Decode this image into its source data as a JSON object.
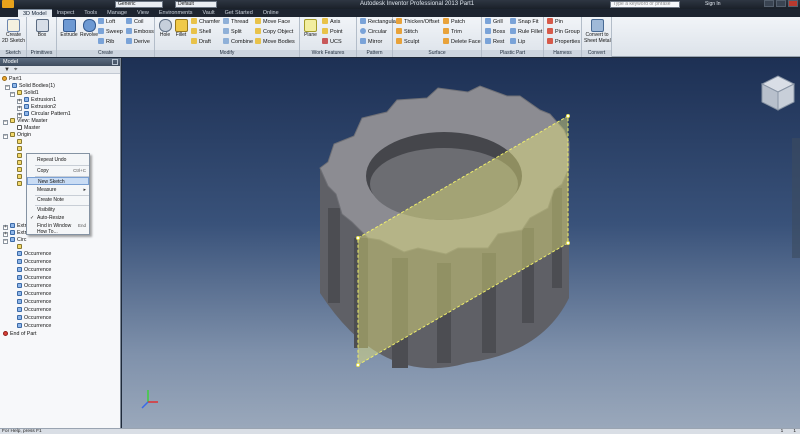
{
  "titlebar": {
    "app_title": "Autodesk Inventor Professional 2013    Part1",
    "material": "Generic",
    "appearance": "Default",
    "search_placeholder": "Type a keyword or phrase",
    "sign_in": "Sign In"
  },
  "tabs": [
    "3D Model",
    "Inspect",
    "Tools",
    "Manage",
    "View",
    "Environments",
    "Vault",
    "Get Started",
    "Online"
  ],
  "ribbon": {
    "sketch": {
      "title": "Sketch",
      "create_2d": "Create",
      "create_2d_sub": "2D Sketch"
    },
    "primitives": {
      "title": "Primitives",
      "box": "Box"
    },
    "create": {
      "title": "Create",
      "extrude": "Extrude",
      "revolve": "Revolve",
      "loft": "Loft",
      "sweep": "Sweep",
      "rib": "Rib",
      "coil": "Coil",
      "emboss": "Emboss",
      "derive": "Derive"
    },
    "modify": {
      "title": "Modify",
      "hole": "Hole",
      "fillet": "Fillet",
      "chamfer": "Chamfer",
      "shell": "Shell",
      "draft": "Draft",
      "thread": "Thread",
      "split": "Split",
      "combine": "Combine",
      "move_face": "Move Face",
      "copy_object": "Copy Object",
      "move_bodies": "Move Bodies"
    },
    "work_features": {
      "title": "Work Features",
      "plane": "Plane",
      "axis": "Axis",
      "point": "Point",
      "ucs": "UCS"
    },
    "pattern": {
      "title": "Pattern",
      "rectangular": "Rectangular",
      "circular": "Circular",
      "mirror": "Mirror"
    },
    "surface": {
      "title": "Surface",
      "thicken": "Thicken/Offset",
      "stitch": "Stitch",
      "sculpt": "Sculpt",
      "patch": "Patch",
      "trim": "Trim",
      "delete_face": "Delete Face"
    },
    "plastic_part": {
      "title": "Plastic Part",
      "grill": "Grill",
      "boss": "Boss",
      "rest": "Rest",
      "snap_fit": "Snap Fit",
      "rule_fillet": "Rule Fillet",
      "lip": "Lip"
    },
    "harness": {
      "title": "Harness",
      "pin": "Pin",
      "pin_group": "Pin Group",
      "properties": "Properties"
    },
    "convert": {
      "title": "Convert",
      "label": "Convert to",
      "label2": "Sheet Metal"
    }
  },
  "browser": {
    "header": "Model",
    "tree": [
      "Part1",
      "Solid Bodies(1)",
      "Solid1",
      "Extrusion1",
      "Extrusion2",
      "Circular Pattern1",
      "View: Master",
      "Master",
      "Origin",
      "Extr",
      "Extr",
      "Circ",
      "Occurrence",
      "Occurrence",
      "Occurrence",
      "Occurrence",
      "Occurrence",
      "Occurrence",
      "Occurrence",
      "Occurrence",
      "Occurrence",
      "Occurrence",
      "End of Part"
    ]
  },
  "context_menu": {
    "items": [
      {
        "label": "Repeat Undo",
        "shortcut": ""
      },
      {
        "label": "Copy",
        "shortcut": "Ctrl+C"
      },
      {
        "label": "New Sketch",
        "shortcut": ""
      },
      {
        "label": "Measure",
        "shortcut": ""
      },
      {
        "label": "Create Note",
        "shortcut": ""
      },
      {
        "label": "Visibility",
        "shortcut": ""
      },
      {
        "label": "Auto-Resize",
        "shortcut": ""
      },
      {
        "label": "Find in Window",
        "shortcut": "End"
      },
      {
        "label": "How To...",
        "shortcut": ""
      }
    ],
    "highlighted_index": 2
  },
  "status": {
    "help": "For Help, press F1",
    "count1": "1",
    "count2": "1"
  },
  "colors": {
    "gear_face": "#8c8c92",
    "gear_side": "#55565c",
    "plane_fill": "#e6e57a",
    "plane_edge": "#f0ef6a"
  }
}
